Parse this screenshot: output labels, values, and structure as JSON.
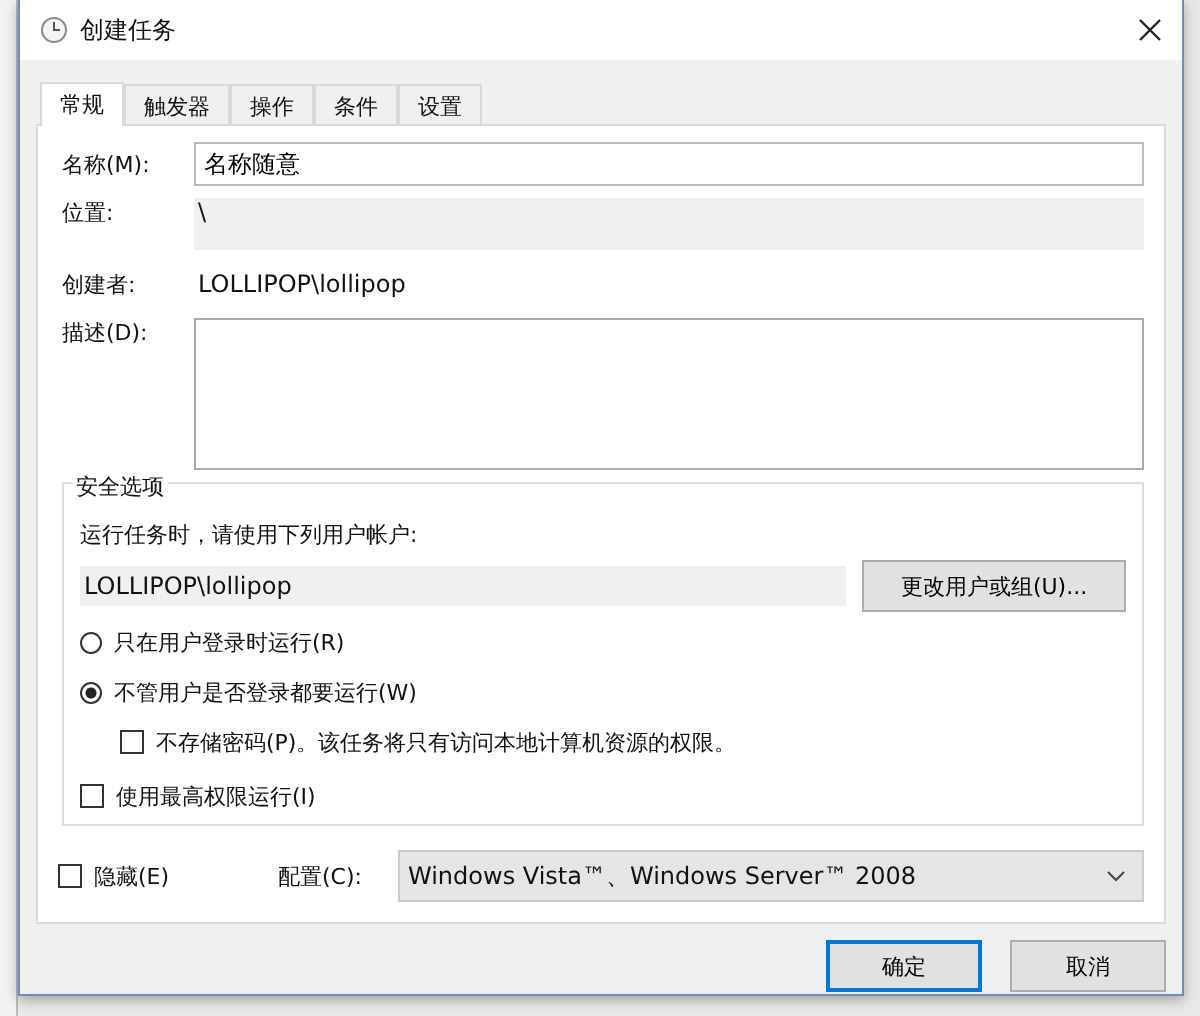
{
  "window": {
    "title": "创建任务"
  },
  "tabs": [
    {
      "label": "常规",
      "selected": true
    },
    {
      "label": "触发器",
      "selected": false
    },
    {
      "label": "操作",
      "selected": false
    },
    {
      "label": "条件",
      "selected": false
    },
    {
      "label": "设置",
      "selected": false
    }
  ],
  "general": {
    "name_label": "名称(M):",
    "name_value": "名称随意",
    "location_label": "位置:",
    "location_value": "\\",
    "author_label": "创建者:",
    "author_value": "LOLLIPOP\\lollipop",
    "description_label": "描述(D):"
  },
  "security": {
    "title": "安全选项",
    "account_prompt": "运行任务时，请使用下列用户帐户:",
    "account_value": "LOLLIPOP\\lollipop",
    "change_button": "更改用户或组(U)...",
    "run_options": [
      {
        "label": "只在用户登录时运行(R)",
        "selected": false
      },
      {
        "label": "不管用户是否登录都要运行(W)",
        "selected": true
      }
    ],
    "no_store_password": {
      "label": "不存储密码(P)。该任务将只有访问本地计算机资源的权限。",
      "checked": false
    },
    "highest_privileges": {
      "label": "使用最高权限运行(I)",
      "checked": false
    }
  },
  "hidden": {
    "label": "隐藏(E)",
    "checked": false
  },
  "configure": {
    "label": "配置(C):",
    "value": "Windows Vista™、Windows Server™ 2008"
  },
  "buttons": [
    {
      "label": "确定",
      "default": true
    },
    {
      "label": "取消",
      "default": false
    }
  ]
}
